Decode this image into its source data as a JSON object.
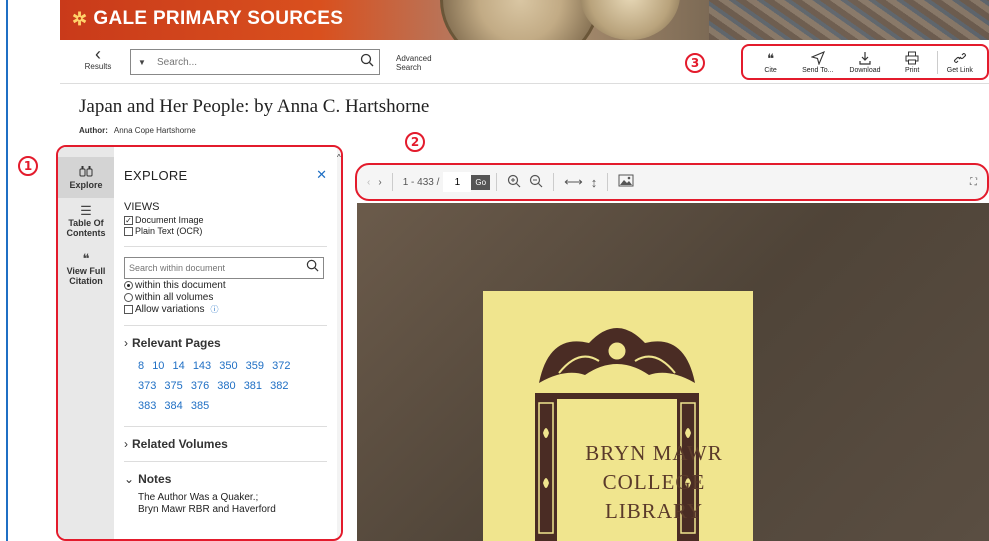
{
  "banner": {
    "logo_text": "GALE PRIMARY SOURCES",
    "logo_icon": "gale-star-icon",
    "brand_color": "#d9501e"
  },
  "toolbar": {
    "results_label": "Results",
    "search_placeholder": "Search...",
    "advanced_label_1": "Advanced",
    "advanced_label_2": "Search",
    "tools": [
      {
        "label": "Cite",
        "icon": "quote-icon"
      },
      {
        "label": "Send To...",
        "icon": "send-icon"
      },
      {
        "label": "Download",
        "icon": "download-icon"
      },
      {
        "label": "Print",
        "icon": "print-icon"
      },
      {
        "label": "Get Link",
        "icon": "link-icon"
      }
    ]
  },
  "callouts": {
    "one": "1",
    "two": "2",
    "three": "3",
    "color": "#e31b2c"
  },
  "document": {
    "title": "Japan and Her People: by Anna C. Hartshorne",
    "author_label": "Author:",
    "author": "Anna Cope Hartshorne"
  },
  "rail": [
    {
      "label_1": "Explore",
      "label_2": "",
      "icon": "binoculars-icon"
    },
    {
      "label_1": "Table Of",
      "label_2": "Contents",
      "icon": "list-icon"
    },
    {
      "label_1": "View Full",
      "label_2": "Citation",
      "icon": "quote-icon"
    }
  ],
  "explore": {
    "heading": "EXPLORE",
    "views_label": "VIEWS",
    "views": [
      {
        "label": "Document Image",
        "checked": true
      },
      {
        "label": "Plain Text (OCR)",
        "checked": false
      }
    ],
    "search_placeholder": "Search within document",
    "scope": [
      {
        "label": "within this document",
        "selected": true
      },
      {
        "label": "within all volumes",
        "selected": false
      }
    ],
    "allow_variations": "Allow variations",
    "relevant_pages_label": "Relevant Pages",
    "relevant_pages": [
      "8",
      "10",
      "14",
      "143",
      "350",
      "359",
      "372",
      "373",
      "375",
      "376",
      "380",
      "381",
      "382",
      "383",
      "384",
      "385"
    ],
    "related_volumes_label": "Related Volumes",
    "notes_label": "Notes",
    "notes_line_1": "The Author Was a Quaker.;",
    "notes_line_2": "Bryn Mawr RBR and Haverford"
  },
  "viewer": {
    "page_range": "1 - 433 /",
    "page_value": "1",
    "go_label": "Go",
    "plate_lines": [
      "BRYN MAWR",
      "COLLEGE",
      "LIBRARY"
    ]
  }
}
